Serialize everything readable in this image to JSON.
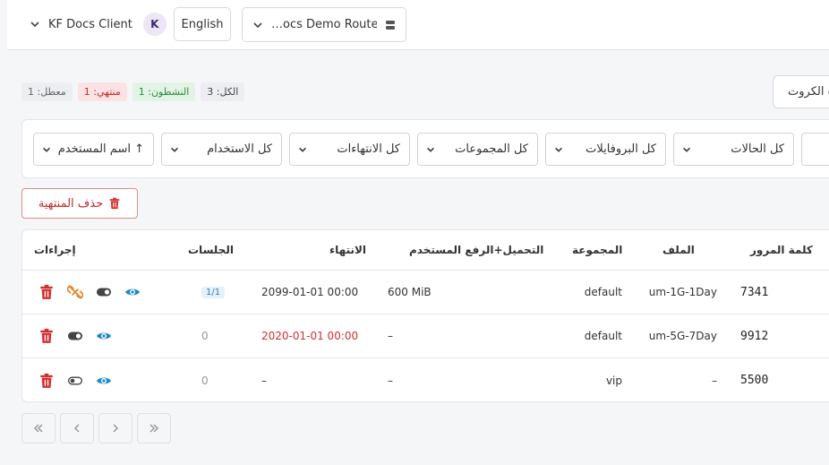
{
  "header": {
    "client_name": "KF Docs Client",
    "avatar_letter": "K",
    "language": "English",
    "router": "…ocs Demo Router"
  },
  "counts": {
    "disabled": "معطل: 1",
    "expired": "منتهي: 1",
    "active": "النشطون: 1",
    "all": "الكل: 3"
  },
  "search_label": "بحث الكروت",
  "filters": {
    "statuses": "كل الحالات",
    "profiles": "كل البروفايلات",
    "groups": "كل المجموعات",
    "expiry": "كل الانتهاءات",
    "usage": "كل الاستخدام",
    "sort": "اسم المستخدم ↑"
  },
  "delete_expired_label": "حذف المنتهية",
  "table": {
    "columns": {
      "password": "كلمة المرور",
      "profile": "الملف",
      "group": "المجموعة",
      "usage": "التحميل+الرفع المستخدم",
      "expiry": "الانتهاء",
      "sessions": "الجلسات",
      "actions": "إجراءات"
    },
    "rows": [
      {
        "password": "7341",
        "profile": "um-1G-1Day",
        "group": "default",
        "usage": "600 MiB",
        "expiry": "2099-01-01 00:00",
        "sessions": "1/1",
        "status": "active"
      },
      {
        "password": "9912",
        "profile": "um-5G-7Day",
        "group": "default",
        "usage": "–",
        "expiry": "2020-01-01 00:00",
        "sessions": "0",
        "status": "expired"
      },
      {
        "password": "5500",
        "profile": "–",
        "group": "vip",
        "usage": "–",
        "expiry": "–",
        "sessions": "0",
        "status": "disabled"
      }
    ]
  },
  "colors": {
    "danger": "#d32f2f",
    "warning": "#e6862b",
    "info": "#1e88c8",
    "toggle": "#444444"
  },
  "icons": [
    "chevron-down-icon",
    "server-icon",
    "trash-icon",
    "unlink-icon",
    "toggle-icon",
    "eye-icon",
    "first-page-icon",
    "prev-page-icon",
    "next-page-icon",
    "last-page-icon"
  ]
}
